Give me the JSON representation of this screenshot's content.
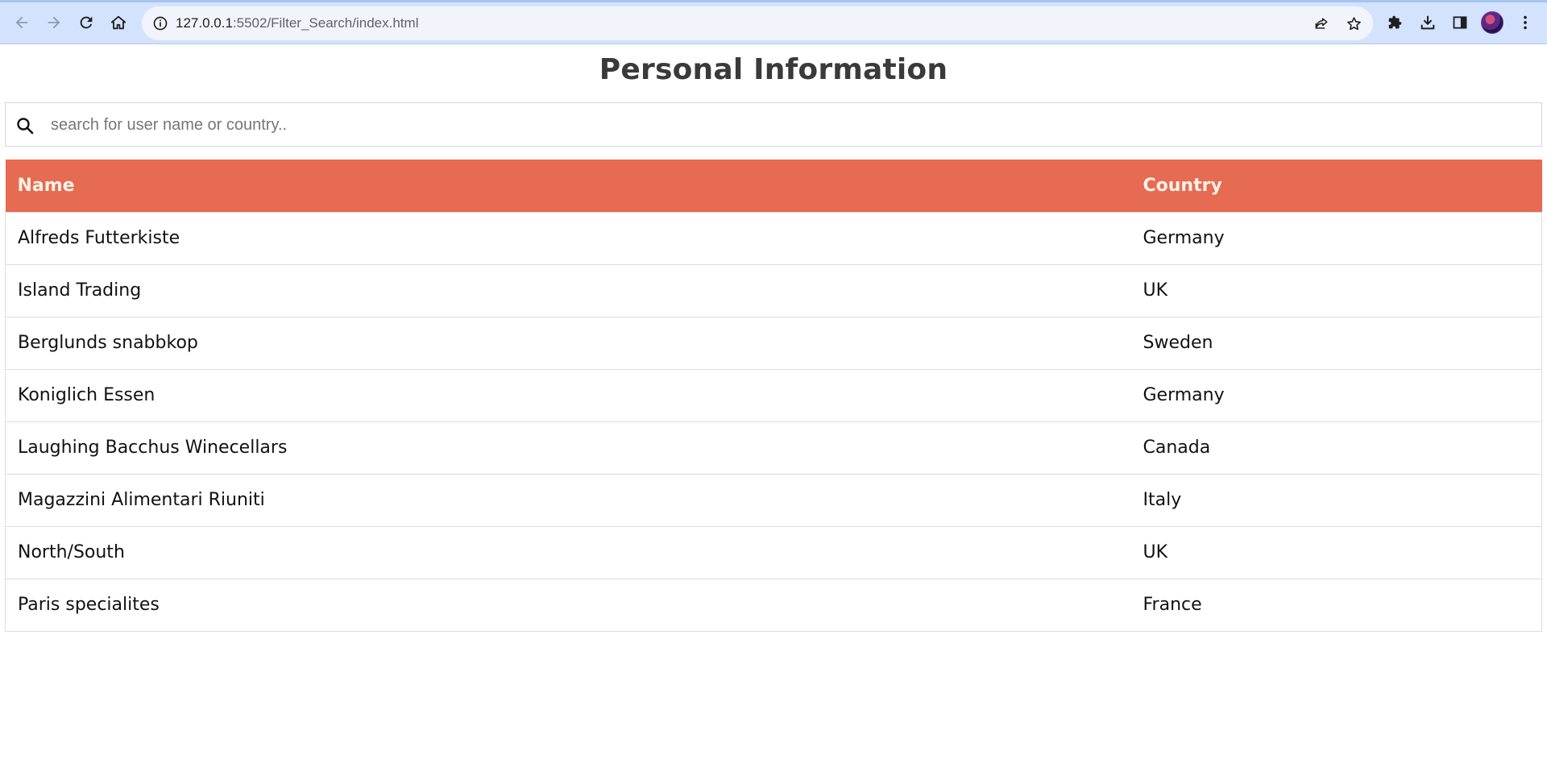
{
  "browser": {
    "url_host": "127.0.0.1",
    "url_path": ":5502/Filter_Search/index.html",
    "icons": {
      "back": "arrow-left-icon",
      "forward": "arrow-right-icon",
      "reload": "reload-icon",
      "home": "home-icon",
      "info": "info-icon",
      "share": "share-icon",
      "bookmark": "star-icon",
      "extensions": "puzzle-icon",
      "downloads": "download-icon",
      "side_panel": "side-panel-icon",
      "profile": "avatar",
      "menu": "kebab-menu-icon"
    },
    "colors": {
      "toolbar": "#d3e3fd",
      "omnibox": "#f1f4fa"
    }
  },
  "page": {
    "title": "Personal Information",
    "search": {
      "placeholder": "search for user name or country..",
      "value": ""
    },
    "table": {
      "headers": {
        "name": "Name",
        "country": "Country"
      },
      "rows": [
        {
          "name": "Alfreds Futterkiste",
          "country": "Germany"
        },
        {
          "name": "Island Trading",
          "country": "UK"
        },
        {
          "name": "Berglunds snabbkop",
          "country": "Sweden"
        },
        {
          "name": "Koniglich Essen",
          "country": "Germany"
        },
        {
          "name": "Laughing Bacchus Winecellars",
          "country": "Canada"
        },
        {
          "name": "Magazzini Alimentari Riuniti",
          "country": "Italy"
        },
        {
          "name": "North/South",
          "country": "UK"
        },
        {
          "name": "Paris specialites",
          "country": "France"
        }
      ]
    },
    "colors": {
      "header_bg": "#e76a52",
      "header_text": "#fff3e6",
      "title": "#3a3a3a"
    }
  }
}
